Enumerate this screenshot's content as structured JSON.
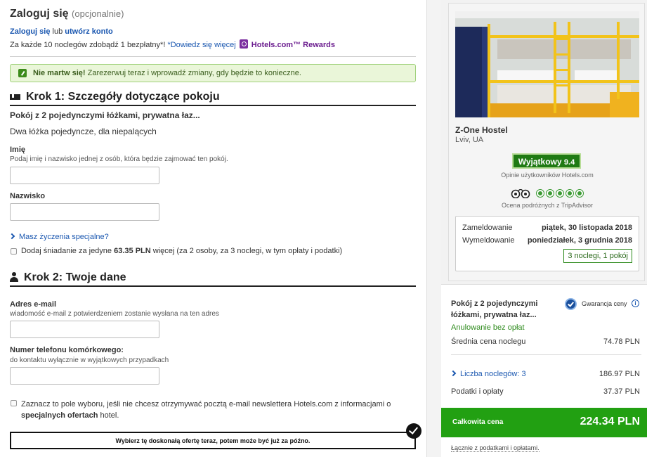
{
  "login": {
    "title": "Zaloguj się",
    "optional": "(opcjonalnie)",
    "login_link": "Zaloguj się",
    "or": "lub",
    "create_link": "utwórz konto",
    "rewards_text": "Za każde 10 noclegów zdobądź 1 bezpłatny*!",
    "learn_more": "*Dowiedz się więcej",
    "rewards_brand": "Hotels.com™ Rewards"
  },
  "notice": {
    "bold": "Nie martw się!",
    "text": "Zarezerwuj teraz i wprowadź zmiany, gdy będzie to konieczne."
  },
  "step1": {
    "title": "Krok 1: Szczegóły dotyczące pokoju",
    "room_name": "Pokój z 2 pojedynczymi łóżkami, prywatna łaz...",
    "room_beds": "Dwa łóżka pojedyncze, dla niepalących",
    "first_name_label": "Imię",
    "first_name_hint": "Podaj imię i nazwisko jednej z osób, która będzie zajmować ten pokój.",
    "first_name_value": "",
    "last_name_label": "Nazwisko",
    "last_name_value": "",
    "special_requests": "Masz życzenia specjalne?",
    "breakfast_pre": "Dodaj śniadanie za jedyne",
    "breakfast_price": "63.35 PLN",
    "breakfast_post": "więcej (za 2 osoby, za 3 noclegi, w tym opłaty i podatki)"
  },
  "step2": {
    "title": "Krok 2: Twoje dane",
    "email_label": "Adres e-mail",
    "email_hint": "wiadomość e-mail z potwierdzeniem zostanie wysłana na ten adres",
    "email_value": "",
    "phone_label": "Numer telefonu komórkowego:",
    "phone_hint": "do kontaktu wyłącznie w wyjątkowych przypadkach",
    "phone_value": "",
    "newsletter_pre": "Zaznacz to pole wyboru, jeśli nie chcesz otrzymywać pocztą e-mail newslettera Hotels.com z informacjami o",
    "newsletter_bold": "specjalnych ofertach",
    "newsletter_post": "hotel.",
    "offer_banner": "Wybierz tę doskonałą ofertę teraz, potem może być już za późno."
  },
  "hotel": {
    "name": "Z-One Hostel",
    "city": "Lviv, UA",
    "rating_word": "Wyjątkowy",
    "rating_score": "9.4",
    "rating_caption": "Opinie użytkowników Hotels.com",
    "tripadvisor_caption": "Ocena podróżnych z TripAdvisor",
    "tripadvisor_circles": 5,
    "checkin_label": "Zameldowanie",
    "checkin_date": "piątek, 30 listopada 2018",
    "checkout_label": "Wymeldowanie",
    "checkout_date": "poniedziałek, 3 grudnia 2018",
    "nights_summary": "3 noclegi, 1 pokój"
  },
  "summary": {
    "room": "Pokój z 2 pojedynczymi łóżkami, prywatna łaz...",
    "guarantee": "Gwarancja ceny",
    "cancel": "Anulowanie bez opłat",
    "avg_label": "Średnia cena noclegu",
    "avg_value": "74.78 PLN",
    "nights_label": "Liczba noclegów: 3",
    "nights_value": "186.97 PLN",
    "tax_label": "Podatki i opłaty",
    "tax_value": "37.37 PLN",
    "total_label": "Całkowita cena",
    "total_value": "224.34 PLN",
    "incl": "Łącznie z podatkami i opłatami."
  },
  "colors": {
    "link": "#1a57b0",
    "success": "#22a012",
    "rewards": "#6b1d8f",
    "rating_badge": "#1f7a13"
  }
}
